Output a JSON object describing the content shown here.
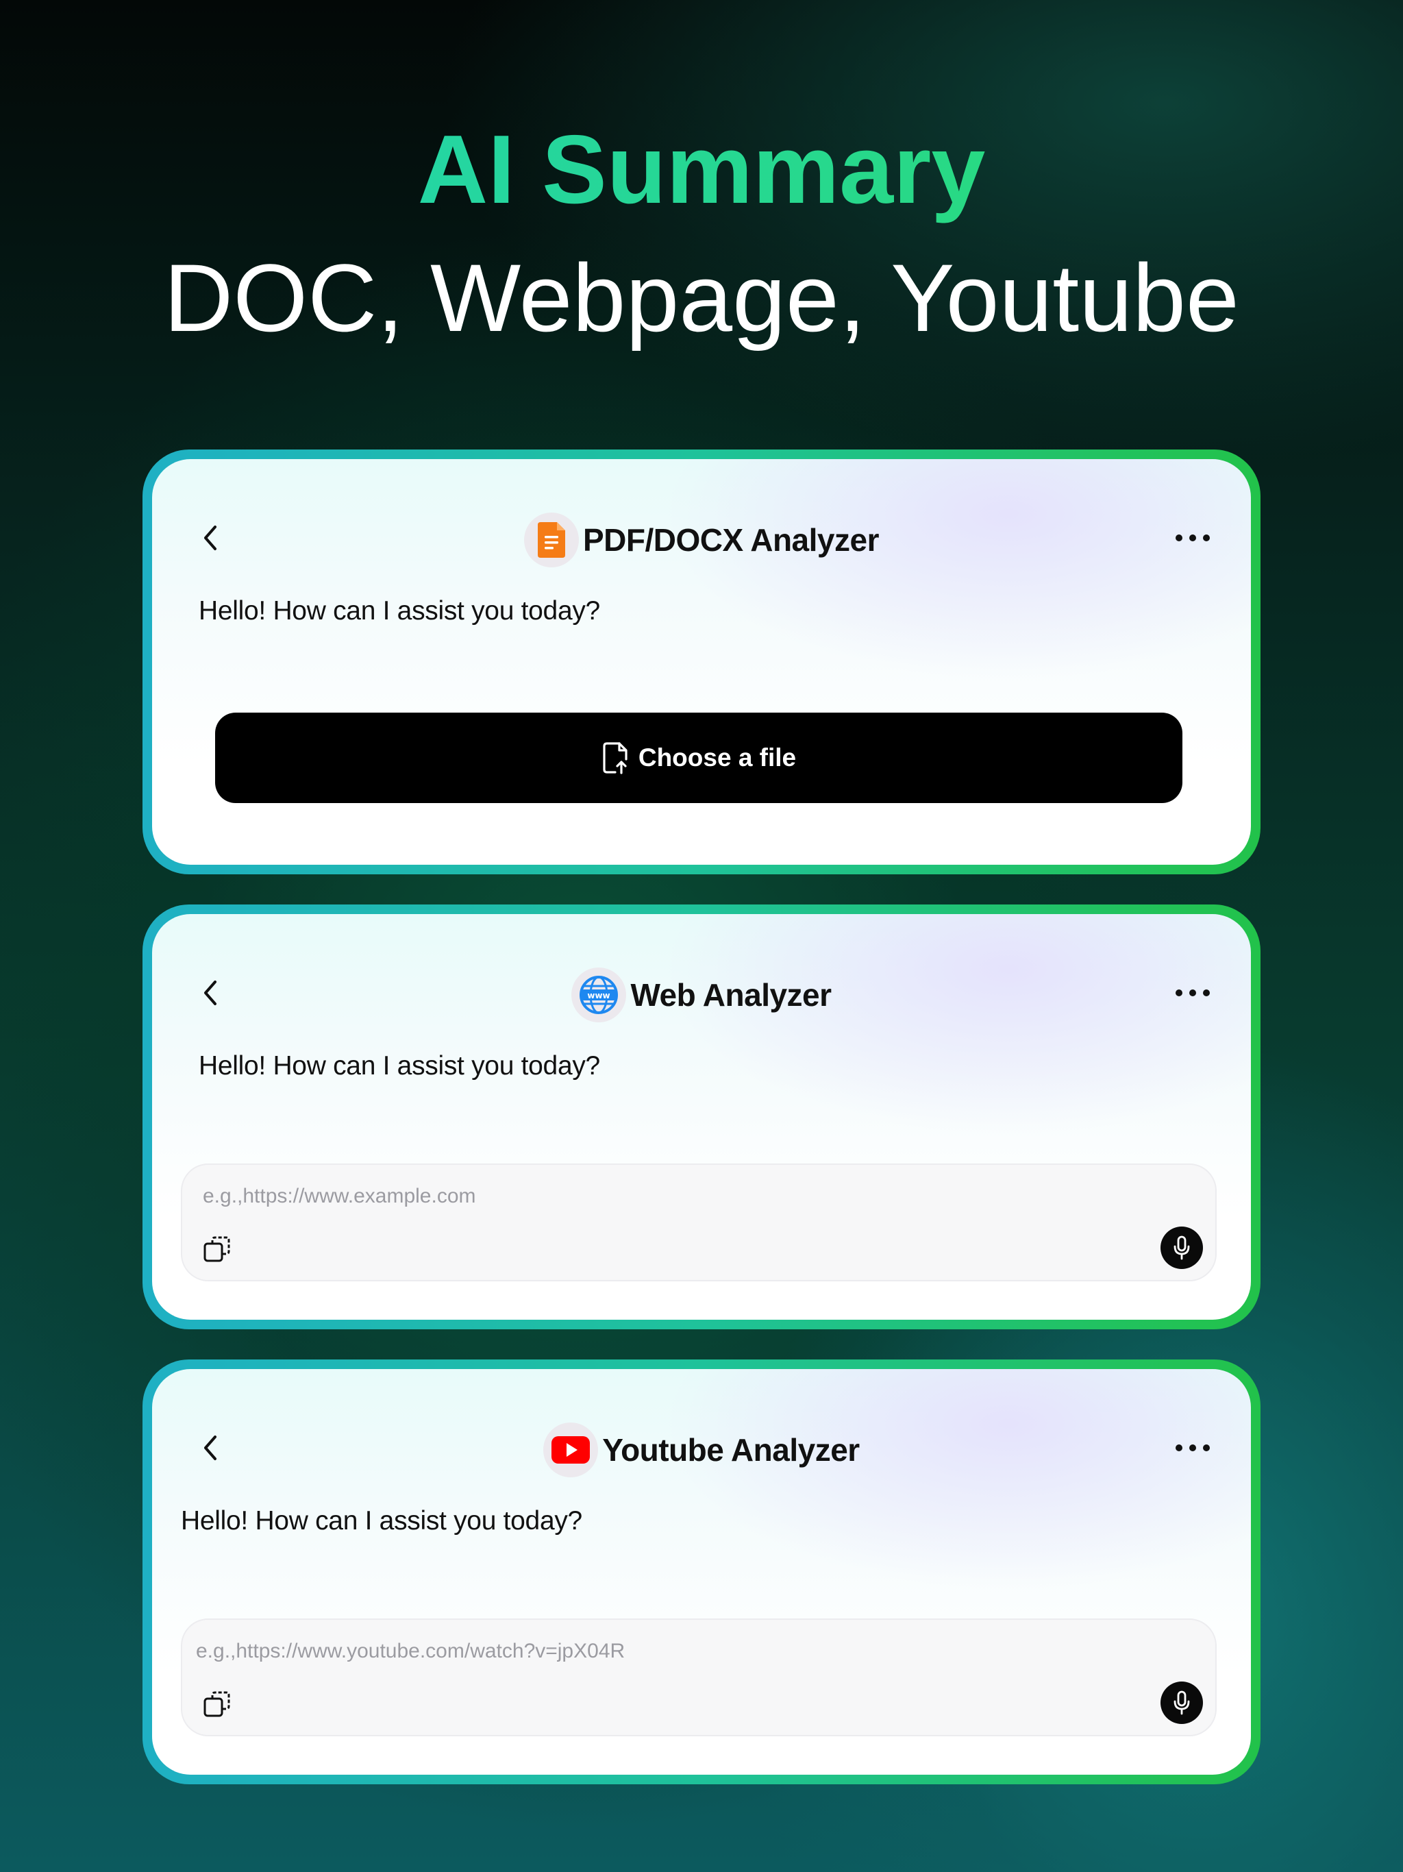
{
  "hero": {
    "title": "AI Summary",
    "subtitle": "DOC, Webpage, Youtube"
  },
  "cards": [
    {
      "title": "PDF/DOCX Analyzer",
      "icon": "document-icon",
      "greeting": "Hello! How can I assist you today?",
      "action_label": "Choose a file",
      "action_icon": "file-upload-icon"
    },
    {
      "title": "Web Analyzer",
      "icon": "globe-www-icon",
      "greeting": "Hello! How can I assist you today?",
      "input_placeholder": "e.g.,https://www.example.com",
      "input_value": ""
    },
    {
      "title": "Youtube Analyzer",
      "icon": "youtube-icon",
      "greeting": "Hello! How can I assist you today?",
      "input_placeholder": "e.g.,https://www.youtube.com/watch?v=jpX04R",
      "input_value": ""
    }
  ],
  "colors": {
    "accent_gradient": [
      "#1fb0c4",
      "#22c24a"
    ],
    "title_gradient": [
      "#22d3b8",
      "#2ddc6a"
    ],
    "document_orange": "#f57c16",
    "web_blue": "#1e88f0",
    "youtube_red": "#ff0000"
  }
}
